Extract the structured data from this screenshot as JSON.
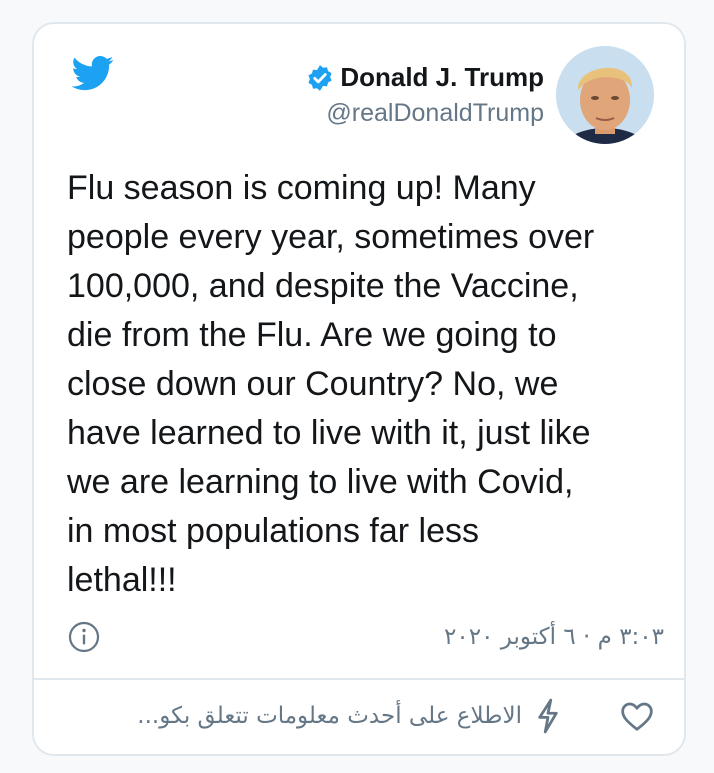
{
  "tweet": {
    "display_name": "Donald J. Trump",
    "handle": "@realDonaldTrump",
    "text": "Flu season is coming up! Many\npeople every year, sometimes over\n100,000, and despite the Vaccine,\ndie from the Flu. Are we going to\nclose down our Country? No, we\nhave learned to live with it, just like\nwe are learning to live with Covid,\nin most populations far less\nlethal!!!",
    "timestamp": "٣:٠٣ م · ٦ أكتوبر ٢٠٢٠",
    "topics_link": "الاطلاع على أحدث معلومات تتعلق بكو..."
  },
  "icons": {
    "brand": "twitter-bird-icon",
    "verified": "verified-badge-icon",
    "info": "info-icon",
    "like": "heart-icon",
    "topic": "lightning-bolt-icon"
  },
  "colors": {
    "twitter_blue": "#1da1f2",
    "text": "#14171a",
    "secondary": "#657786",
    "border": "#e1e8ed"
  }
}
